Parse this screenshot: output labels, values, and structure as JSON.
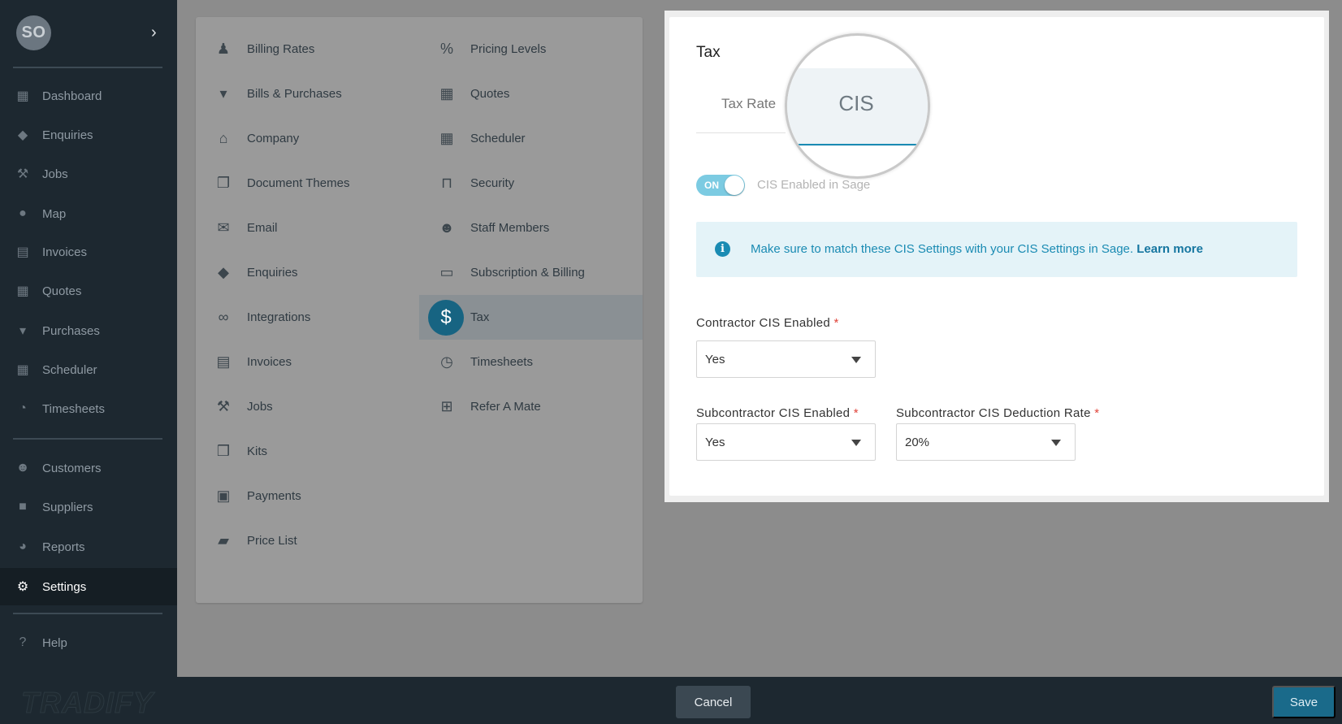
{
  "sidebar": {
    "avatar_initials": "SO",
    "expand_icon": "chevron-right-icon",
    "items": [
      {
        "label": "Dashboard",
        "icon": "dashboard-icon"
      },
      {
        "label": "Enquiries",
        "icon": "tags-icon"
      },
      {
        "label": "Jobs",
        "icon": "hammer-icon"
      },
      {
        "label": "Map",
        "icon": "map-pin-icon"
      },
      {
        "label": "Invoices",
        "icon": "invoice-icon"
      },
      {
        "label": "Quotes",
        "icon": "calculator-icon"
      },
      {
        "label": "Purchases",
        "icon": "cart-icon"
      },
      {
        "label": "Scheduler",
        "icon": "calendar-icon"
      },
      {
        "label": "Timesheets",
        "icon": "clock-icon"
      },
      {
        "label": "Customers",
        "icon": "users-icon"
      },
      {
        "label": "Suppliers",
        "icon": "truck-icon"
      },
      {
        "label": "Reports",
        "icon": "pie-chart-icon"
      },
      {
        "label": "Settings",
        "icon": "gear-icon"
      },
      {
        "label": "Help",
        "icon": "help-icon"
      }
    ],
    "active": "Settings",
    "brand": "TRADIFY"
  },
  "settings_grid": {
    "left": [
      {
        "label": "Billing Rates",
        "icon": "person-icon"
      },
      {
        "label": "Bills & Purchases",
        "icon": "cart-icon"
      },
      {
        "label": "Company",
        "icon": "home-icon"
      },
      {
        "label": "Document Themes",
        "icon": "copy-icon"
      },
      {
        "label": "Email",
        "icon": "envelope-icon"
      },
      {
        "label": "Enquiries",
        "icon": "tags-icon"
      },
      {
        "label": "Integrations",
        "icon": "link-icon"
      },
      {
        "label": "Invoices",
        "icon": "file-icon"
      },
      {
        "label": "Jobs",
        "icon": "hammer-icon"
      },
      {
        "label": "Kits",
        "icon": "cubes-icon"
      },
      {
        "label": "Payments",
        "icon": "money-icon"
      },
      {
        "label": "Price List",
        "icon": "book-icon"
      }
    ],
    "right": [
      {
        "label": "Pricing Levels",
        "icon": "percent-icon"
      },
      {
        "label": "Quotes",
        "icon": "calculator-icon"
      },
      {
        "label": "Scheduler",
        "icon": "calendar-icon"
      },
      {
        "label": "Security",
        "icon": "unlock-icon"
      },
      {
        "label": "Staff Members",
        "icon": "users-icon"
      },
      {
        "label": "Subscription & Billing",
        "icon": "credit-card-icon"
      },
      {
        "label": "Tax",
        "icon": "dollar-icon"
      },
      {
        "label": "Timesheets",
        "icon": "clock-icon"
      },
      {
        "label": "Refer A Mate",
        "icon": "gift-icon"
      }
    ],
    "selected": "Tax"
  },
  "tax_card": {
    "title": "Tax",
    "tabs": [
      "Tax Rate",
      "CIS"
    ],
    "active_tab": "CIS",
    "toggle": {
      "state": "ON",
      "label": "CIS Enabled in Sage"
    },
    "info": {
      "text": "Make sure to match these CIS Settings with your CIS Settings in Sage.",
      "link": "Learn more"
    },
    "fields": {
      "contractor_enabled": {
        "label": "Contractor CIS Enabled",
        "required": "*",
        "value": "Yes"
      },
      "subcontractor_enabled": {
        "label": "Subcontractor CIS Enabled",
        "required": "*",
        "value": "Yes"
      },
      "subcontractor_rate": {
        "label": "Subcontractor CIS Deduction Rate",
        "required": "*",
        "value": "20%"
      }
    }
  },
  "footer": {
    "cancel_label": "Cancel",
    "save_label": "Save"
  },
  "colors": {
    "sidebar_bg": "#1d2830",
    "accent": "#1a8bb3",
    "save_button": "#1a6a8a",
    "selected_icon_bg": "#176482",
    "required": "#e0443a"
  }
}
